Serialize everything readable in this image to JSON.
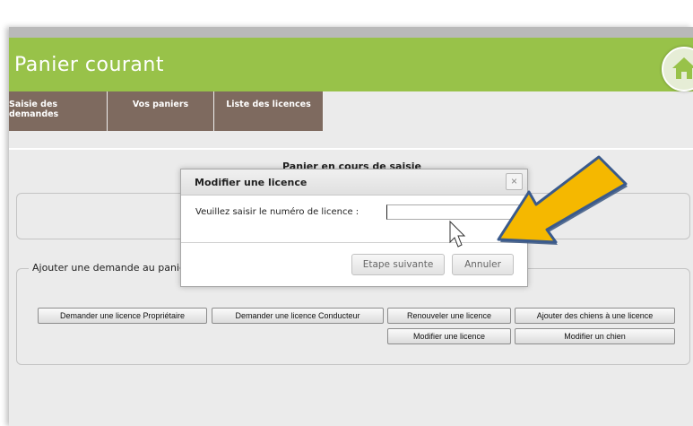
{
  "header": {
    "title": "Panier courant"
  },
  "nav": {
    "tabs": [
      {
        "label": "Saisie des demandes"
      },
      {
        "label": "Vos paniers"
      },
      {
        "label": "Liste des licences"
      }
    ]
  },
  "section": {
    "title": "Panier en cours de saisie"
  },
  "fieldset": {
    "legend": "Ajouter une demande au panier",
    "buttons": [
      "Demander une licence Propriétaire",
      "Demander une licence Conducteur",
      "Renouveler une licence",
      "Ajouter des chiens à une licence",
      "Modifier une licence",
      "Modifier un chien"
    ]
  },
  "dialog": {
    "title": "Modifier une licence",
    "close_glyph": "×",
    "label": "Veuillez saisir le numéro de licence :",
    "input_value": "",
    "next_label": "Etape suivante",
    "cancel_label": "Annuler"
  },
  "colors": {
    "header": "#98c249",
    "nav": "#7e6a5f",
    "arrow": "#f5b800"
  },
  "icons": [
    "home-icon",
    "close-icon",
    "mouse-cursor",
    "pointer-arrow"
  ]
}
